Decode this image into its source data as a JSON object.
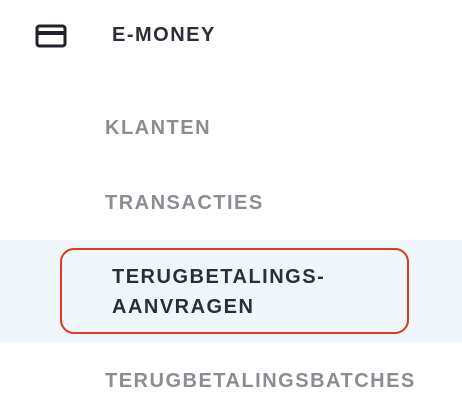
{
  "section": {
    "icon": "credit-card-icon",
    "title": "E-MONEY"
  },
  "nav": {
    "items": [
      {
        "label": "KLANTEN",
        "active": false
      },
      {
        "label": "TRANSACTIES",
        "active": false
      },
      {
        "label": "TERUGBETALINGS-\nAANVRAGEN",
        "active": true
      },
      {
        "label": "TERUGBETALINGSBATCHES",
        "active": false
      }
    ]
  },
  "colors": {
    "active_outline": "#e0391f",
    "active_background": "#f1f6fb",
    "active_text": "#2b2f38",
    "inactive_text": "#8a8d91"
  }
}
